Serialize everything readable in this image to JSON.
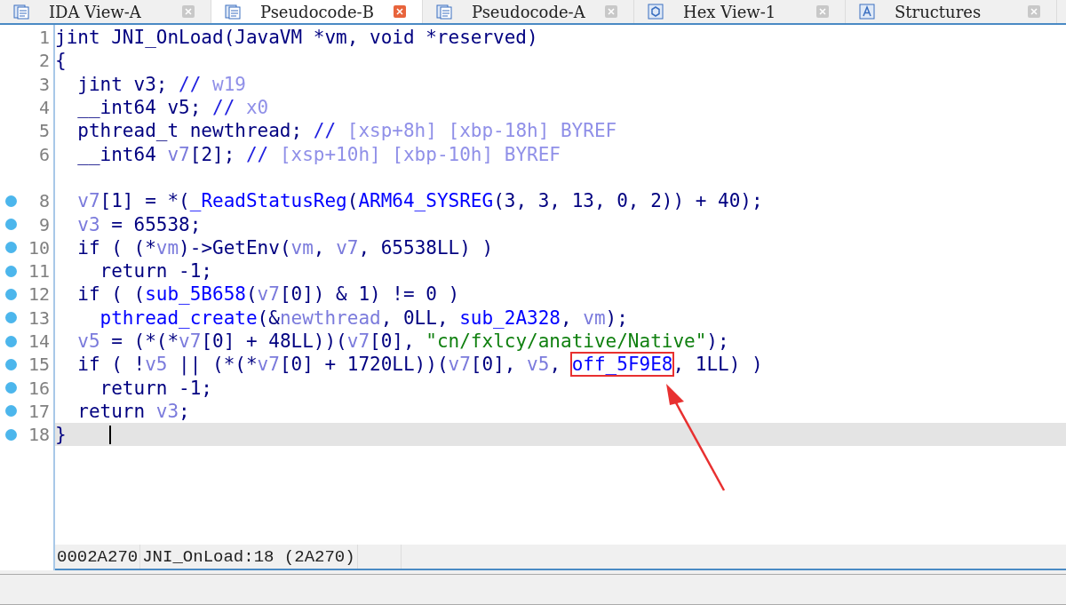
{
  "tabs": [
    {
      "label": "IDA View-A",
      "selected": false
    },
    {
      "label": "Pseudocode-B",
      "selected": true
    },
    {
      "label": "Pseudocode-A",
      "selected": false
    },
    {
      "label": "Hex View-1",
      "selected": false
    },
    {
      "label": "Structures",
      "selected": false
    }
  ],
  "code_lines": [
    {
      "number": "1",
      "breakpoint": false,
      "current": false,
      "tokens": [
        {
          "kind": "plain",
          "text": "jint JNI_OnLoad(JavaVM *vm, void *reserved)"
        }
      ]
    },
    {
      "number": "2",
      "breakpoint": false,
      "current": false,
      "tokens": [
        {
          "kind": "plain",
          "text": "{"
        }
      ]
    },
    {
      "number": "3",
      "breakpoint": false,
      "current": false,
      "tokens": [
        {
          "kind": "plain",
          "text": "  jint v3; "
        },
        {
          "kind": "comment",
          "text": "//"
        },
        {
          "kind": "reg",
          "text": " w19"
        }
      ]
    },
    {
      "number": "4",
      "breakpoint": false,
      "current": false,
      "tokens": [
        {
          "kind": "plain",
          "text": "  __int64 v5; "
        },
        {
          "kind": "comment",
          "text": "//"
        },
        {
          "kind": "reg",
          "text": " x0"
        }
      ]
    },
    {
      "number": "5",
      "breakpoint": false,
      "current": false,
      "tokens": [
        {
          "kind": "plain",
          "text": "  pthread_t newthread; "
        },
        {
          "kind": "comment",
          "text": "//"
        },
        {
          "kind": "reg",
          "text": " [xsp+8h] [xbp-18h] BYREF"
        }
      ]
    },
    {
      "number": "6",
      "breakpoint": false,
      "current": false,
      "tokens": [
        {
          "kind": "plain",
          "text": "  __int64 "
        },
        {
          "kind": "var",
          "text": "v7"
        },
        {
          "kind": "plain",
          "text": "[2]; "
        },
        {
          "kind": "comment",
          "text": "//"
        },
        {
          "kind": "reg",
          "text": " [xsp+10h] [xbp-10h] BYREF"
        }
      ]
    },
    {
      "breakpoint": false,
      "current": false
    },
    {
      "number": "8",
      "breakpoint": true,
      "current": false,
      "tokens": [
        {
          "kind": "var",
          "text": "  v7"
        },
        {
          "kind": "plain",
          "text": "[1] = *("
        },
        {
          "kind": "func",
          "text": "_ReadStatusReg"
        },
        {
          "kind": "plain",
          "text": "("
        },
        {
          "kind": "func",
          "text": "ARM64_SYSREG"
        },
        {
          "kind": "plain",
          "text": "(3, 3, 13, 0, 2)) + 40);"
        }
      ]
    },
    {
      "number": "9",
      "breakpoint": true,
      "current": false,
      "tokens": [
        {
          "kind": "var",
          "text": "  v3"
        },
        {
          "kind": "plain",
          "text": " = 65538;"
        }
      ]
    },
    {
      "number": "10",
      "breakpoint": true,
      "current": false,
      "tokens": [
        {
          "kind": "plain",
          "text": "  if ( (*"
        },
        {
          "kind": "var",
          "text": "vm"
        },
        {
          "kind": "plain",
          "text": ")->GetEnv("
        },
        {
          "kind": "var",
          "text": "vm"
        },
        {
          "kind": "plain",
          "text": ", "
        },
        {
          "kind": "var",
          "text": "v7"
        },
        {
          "kind": "plain",
          "text": ", 65538LL) )"
        }
      ]
    },
    {
      "number": "11",
      "breakpoint": true,
      "current": false,
      "tokens": [
        {
          "kind": "plain",
          "text": "    return -1;"
        }
      ]
    },
    {
      "number": "12",
      "breakpoint": true,
      "current": false,
      "tokens": [
        {
          "kind": "plain",
          "text": "  if ( ("
        },
        {
          "kind": "func",
          "text": "sub_5B658"
        },
        {
          "kind": "plain",
          "text": "("
        },
        {
          "kind": "var",
          "text": "v7"
        },
        {
          "kind": "plain",
          "text": "[0]) & 1) != 0 )"
        }
      ]
    },
    {
      "number": "13",
      "breakpoint": true,
      "current": false,
      "tokens": [
        {
          "kind": "func",
          "text": "    pthread_create"
        },
        {
          "kind": "plain",
          "text": "(&"
        },
        {
          "kind": "var",
          "text": "newthread"
        },
        {
          "kind": "plain",
          "text": ", 0LL, "
        },
        {
          "kind": "func",
          "text": "sub_2A328"
        },
        {
          "kind": "plain",
          "text": ", "
        },
        {
          "kind": "var",
          "text": "vm"
        },
        {
          "kind": "plain",
          "text": ");"
        }
      ]
    },
    {
      "number": "14",
      "breakpoint": true,
      "current": false,
      "tokens": [
        {
          "kind": "var",
          "text": "  v5"
        },
        {
          "kind": "plain",
          "text": " = (*(*"
        },
        {
          "kind": "var",
          "text": "v7"
        },
        {
          "kind": "plain",
          "text": "[0] + 48LL))("
        },
        {
          "kind": "var",
          "text": "v7"
        },
        {
          "kind": "plain",
          "text": "[0], "
        },
        {
          "kind": "str",
          "text": "\"cn/fxlcy/anative/Native\""
        },
        {
          "kind": "plain",
          "text": ");"
        }
      ]
    },
    {
      "number": "15",
      "breakpoint": true,
      "current": false,
      "tokens": [
        {
          "kind": "plain",
          "text": "  if ( !"
        },
        {
          "kind": "var",
          "text": "v5"
        },
        {
          "kind": "plain",
          "text": " || (*(*"
        },
        {
          "kind": "var",
          "text": "v7"
        },
        {
          "kind": "plain",
          "text": "[0] + 1720LL))("
        },
        {
          "kind": "var",
          "text": "v7"
        },
        {
          "kind": "plain",
          "text": "[0], "
        },
        {
          "kind": "var",
          "text": "v5"
        },
        {
          "kind": "plain",
          "text": ", "
        },
        {
          "kind": "boxed",
          "text": "off_5F9E8"
        },
        {
          "kind": "plain",
          "text": ", 1LL) )"
        }
      ]
    },
    {
      "number": "16",
      "breakpoint": true,
      "current": false,
      "tokens": [
        {
          "kind": "plain",
          "text": "    return -1;"
        }
      ]
    },
    {
      "number": "17",
      "breakpoint": true,
      "current": false,
      "tokens": [
        {
          "kind": "plain",
          "text": "  return "
        },
        {
          "kind": "var",
          "text": "v3"
        },
        {
          "kind": "plain",
          "text": ";"
        }
      ]
    },
    {
      "number": "18",
      "breakpoint": true,
      "current": true,
      "tokens": [
        {
          "kind": "plain",
          "text": "}"
        }
      ]
    }
  ],
  "status_bar": [
    "0002A270",
    "JNI_OnLoad:18 (2A270)"
  ]
}
